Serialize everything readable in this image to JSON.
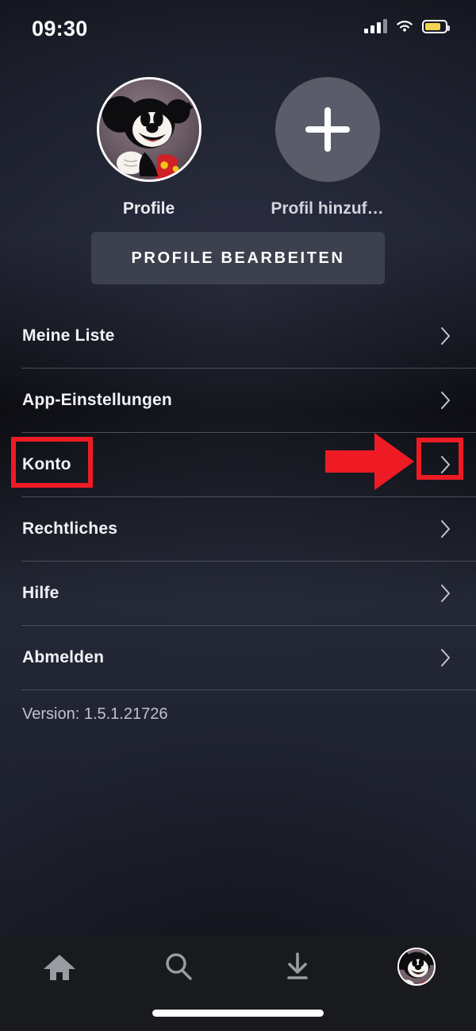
{
  "status_bar": {
    "time": "09:30",
    "signal_icon": "cellular-bars-icon",
    "wifi_icon": "wifi-icon",
    "battery_icon": "battery-icon",
    "battery_color": "#f3d44f",
    "battery_level_percent": 68
  },
  "profiles": {
    "items": [
      {
        "name": "Profile",
        "avatar": "mickey-mouse-avatar",
        "type": "profile"
      },
      {
        "name": "Profil hinzuf…",
        "avatar": "plus-icon",
        "type": "add"
      }
    ]
  },
  "edit_button": {
    "label": "PROFILE BEARBEITEN"
  },
  "menu": {
    "items": [
      {
        "label": "Meine Liste",
        "chevron": "chevron-right-icon"
      },
      {
        "label": "App-Einstellungen",
        "chevron": "chevron-right-icon"
      },
      {
        "label": "Konto",
        "chevron": "chevron-right-icon"
      },
      {
        "label": "Rechtliches",
        "chevron": "chevron-right-icon"
      },
      {
        "label": "Hilfe",
        "chevron": "chevron-right-icon"
      },
      {
        "label": "Abmelden",
        "chevron": "chevron-right-icon"
      }
    ]
  },
  "version": {
    "text": "Version: 1.5.1.21726"
  },
  "annotations": {
    "color": "#ee1b24",
    "highlight_label_box": "Konto",
    "highlight_chevron_box": "chevron-right-icon",
    "arrow": "right-arrow-annotation"
  },
  "tab_bar": {
    "items": [
      {
        "icon": "home-icon",
        "name": "home"
      },
      {
        "icon": "search-icon",
        "name": "search"
      },
      {
        "icon": "download-icon",
        "name": "downloads"
      },
      {
        "icon": "mickey-mouse-avatar",
        "name": "profile"
      }
    ],
    "home_indicator": "home-indicator"
  }
}
